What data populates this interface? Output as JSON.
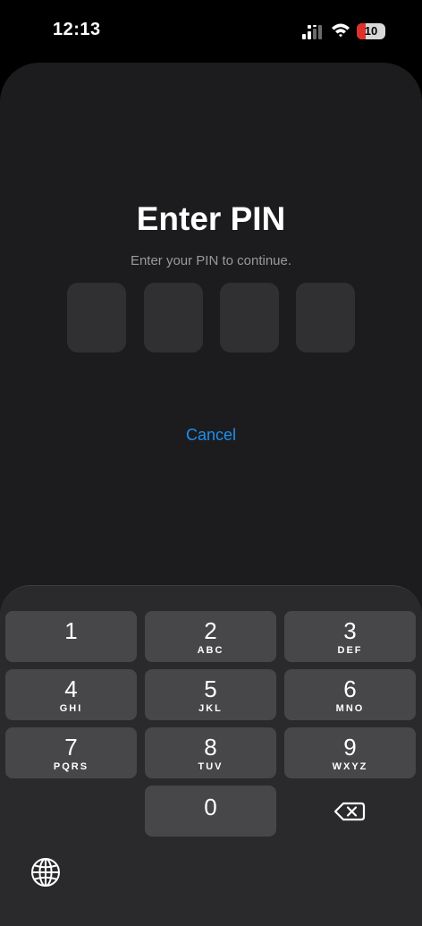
{
  "status_bar": {
    "time": "12:13",
    "battery_level": "10",
    "battery_percent": 10,
    "signal_icon": "signal-bars-icon",
    "wifi_icon": "wifi-icon"
  },
  "pin_screen": {
    "title": "Enter PIN",
    "subtitle": "Enter your PIN to continue.",
    "pin_length": 4,
    "cancel_label": "Cancel"
  },
  "keypad": {
    "keys": [
      {
        "digit": "1",
        "letters": ""
      },
      {
        "digit": "2",
        "letters": "ABC"
      },
      {
        "digit": "3",
        "letters": "DEF"
      },
      {
        "digit": "4",
        "letters": "GHI"
      },
      {
        "digit": "5",
        "letters": "JKL"
      },
      {
        "digit": "6",
        "letters": "MNO"
      },
      {
        "digit": "7",
        "letters": "PQRS"
      },
      {
        "digit": "8",
        "letters": "TUV"
      },
      {
        "digit": "9",
        "letters": "WXYZ"
      },
      {
        "digit": "0",
        "letters": ""
      }
    ],
    "delete_icon": "backspace-icon",
    "globe_icon": "globe-icon"
  },
  "colors": {
    "background": "#000000",
    "sheet": "#1c1c1e",
    "pin_box": "#303032",
    "accent": "#1f8ff0",
    "key": "#474749",
    "battery_low": "#e0302b"
  }
}
